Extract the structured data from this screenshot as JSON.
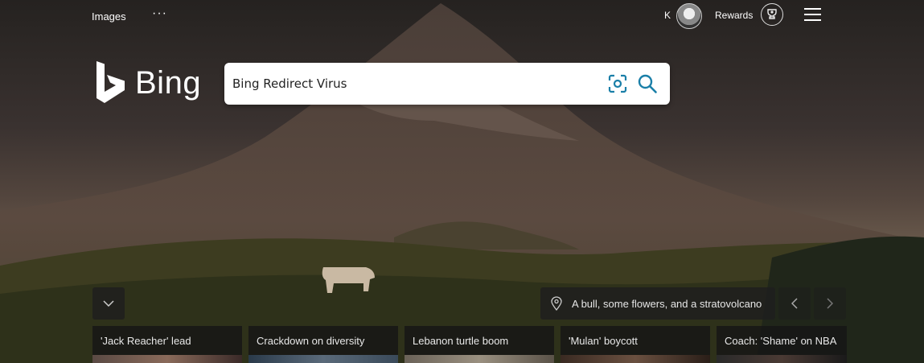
{
  "topbar": {
    "images_label": "Images",
    "more_label": "···",
    "user_initial": "K",
    "rewards_label": "Rewards"
  },
  "logo": {
    "text": "Bing"
  },
  "search": {
    "value": "Bing Redirect Virus",
    "visual_search_icon": "visual-search-icon",
    "search_icon": "search-icon"
  },
  "image_info": {
    "caption": "A bull, some flowers, and a stratovolcano"
  },
  "news": [
    {
      "title": "'Jack Reacher' lead"
    },
    {
      "title": "Crackdown on diversity"
    },
    {
      "title": "Lebanon turtle boom"
    },
    {
      "title": "'Mulan' boycott"
    },
    {
      "title": "Coach: 'Shame' on NBA"
    }
  ],
  "colors": {
    "accent": "#1a7fa8",
    "card_bg": "#161616"
  }
}
